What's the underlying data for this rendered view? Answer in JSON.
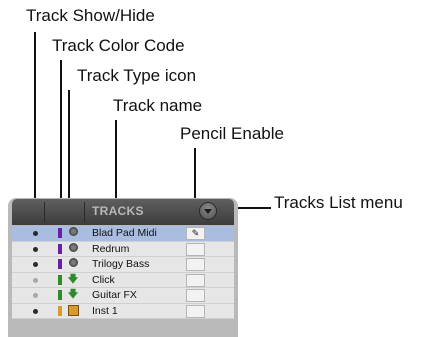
{
  "callouts": {
    "show_hide": "Track Show/Hide",
    "color_code": "Track Color Code",
    "type_icon": "Track Type icon",
    "track_name": "Track name",
    "pencil_enable": "Pencil Enable",
    "list_menu": "Tracks List menu"
  },
  "panel": {
    "title": "TRACKS",
    "menu_icon": "chevron-down-icon"
  },
  "tracks": [
    {
      "name": "Blad Pad Midi",
      "type": "midi-icon",
      "color": "#6a1fa8",
      "shown": true,
      "selected": true,
      "pencil": "✎"
    },
    {
      "name": "Redrum",
      "type": "midi-icon",
      "color": "#6a1fa8",
      "shown": true,
      "selected": false,
      "pencil": ""
    },
    {
      "name": "Trilogy Bass",
      "type": "midi-icon",
      "color": "#6a1fa8",
      "shown": true,
      "selected": false,
      "pencil": ""
    },
    {
      "name": "Click",
      "type": "audio-icon",
      "color": "#2f8a2a",
      "shown": false,
      "selected": false,
      "pencil": ""
    },
    {
      "name": "Guitar FX",
      "type": "audio-icon",
      "color": "#2f8a2a",
      "shown": false,
      "selected": false,
      "pencil": ""
    },
    {
      "name": "Inst 1",
      "type": "instrument-icon",
      "color": "#d99a2c",
      "shown": true,
      "selected": false,
      "pencil": ""
    }
  ],
  "colors": {
    "dot_shown": "#2a2a2a",
    "dot_hidden": "#a8a8a8",
    "selected_row": "#a9bde0"
  }
}
